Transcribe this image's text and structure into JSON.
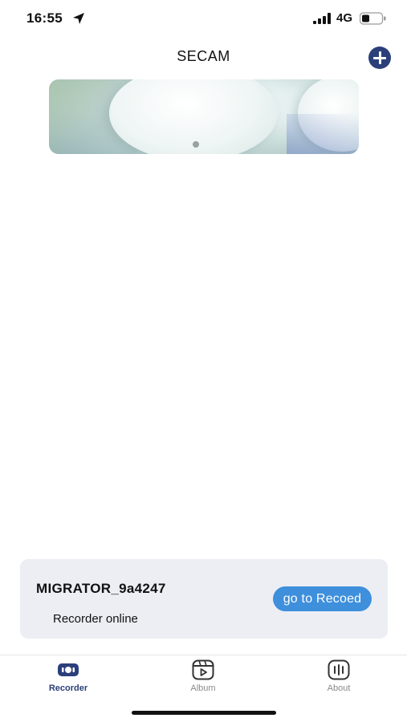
{
  "status_bar": {
    "time": "16:55",
    "network": "4G",
    "icons": [
      "location-arrow-icon",
      "signal-icon",
      "battery-icon"
    ]
  },
  "header": {
    "title": "SECAM",
    "add_icon": "plus-circle-icon"
  },
  "banner": {
    "page_count": 2,
    "active_page": 1
  },
  "device_card": {
    "name": "MIGRATOR_9a4247",
    "status": "Recorder online",
    "action_label": "go to Recoed"
  },
  "tab_bar": {
    "tabs": [
      {
        "label": "Recorder",
        "icon": "recorder-icon",
        "active": true
      },
      {
        "label": "Album",
        "icon": "album-icon",
        "active": false
      },
      {
        "label": "About",
        "icon": "about-icon",
        "active": false
      }
    ]
  },
  "colors": {
    "accent": "#2b3f7a",
    "button_blue": "#3e8fdc",
    "card_bg": "#eceef4",
    "inactive_tab": "#8a8a8a"
  }
}
